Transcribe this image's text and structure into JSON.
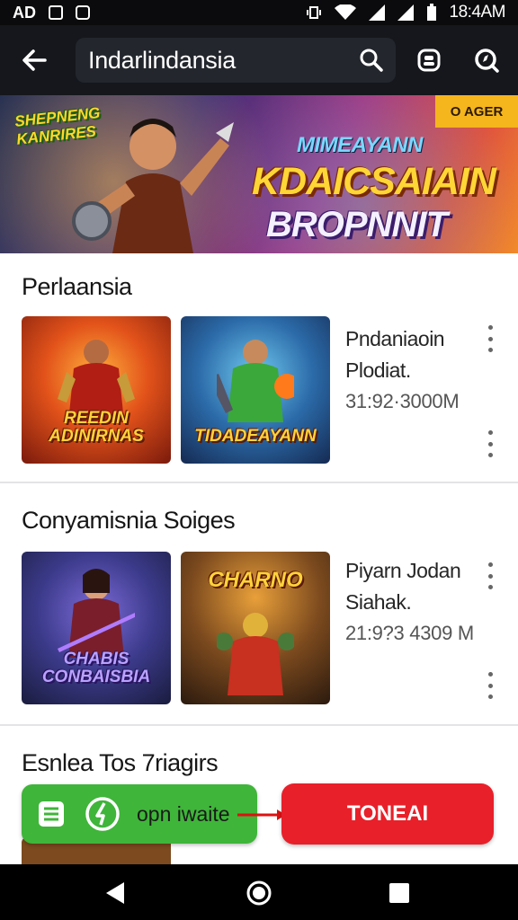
{
  "status_bar": {
    "left_text": "AD",
    "time": "18:4AM"
  },
  "search": {
    "query": "Indarlindansia"
  },
  "banner": {
    "badge_left": "SHEPNENG KANRIRES",
    "tag": "O AGER",
    "subtitle": "MIMEAYANN",
    "title_line1": "KDAICSAIAIN",
    "title_line2": "BROPNNIT"
  },
  "sections": [
    {
      "title": "Perlaansia",
      "thumbs": [
        {
          "label": "REEDIN ADINIRNAS"
        },
        {
          "label": "TIDADEAYANN"
        }
      ],
      "info": {
        "line1": "Pndaniaoin",
        "line2": "Plodiat.",
        "line3": "31:92·3000M"
      }
    },
    {
      "title": "Conyamisnia Soiges",
      "thumbs": [
        {
          "label": "CHABIS CONBAISBIA"
        },
        {
          "label": "CHARNO"
        }
      ],
      "info": {
        "line1": "Piyarn Jodan",
        "line2": "Siahak.",
        "line3": "21:9?3 4309 M"
      }
    },
    {
      "title": "Esnlea Tos 7riagirs"
    }
  ],
  "actions": {
    "green_label": "opn iwaite",
    "red_label": "TONEAI"
  },
  "colors": {
    "accent_green": "#3fb53a",
    "accent_red": "#e8202a",
    "topbar": "#15171c"
  }
}
